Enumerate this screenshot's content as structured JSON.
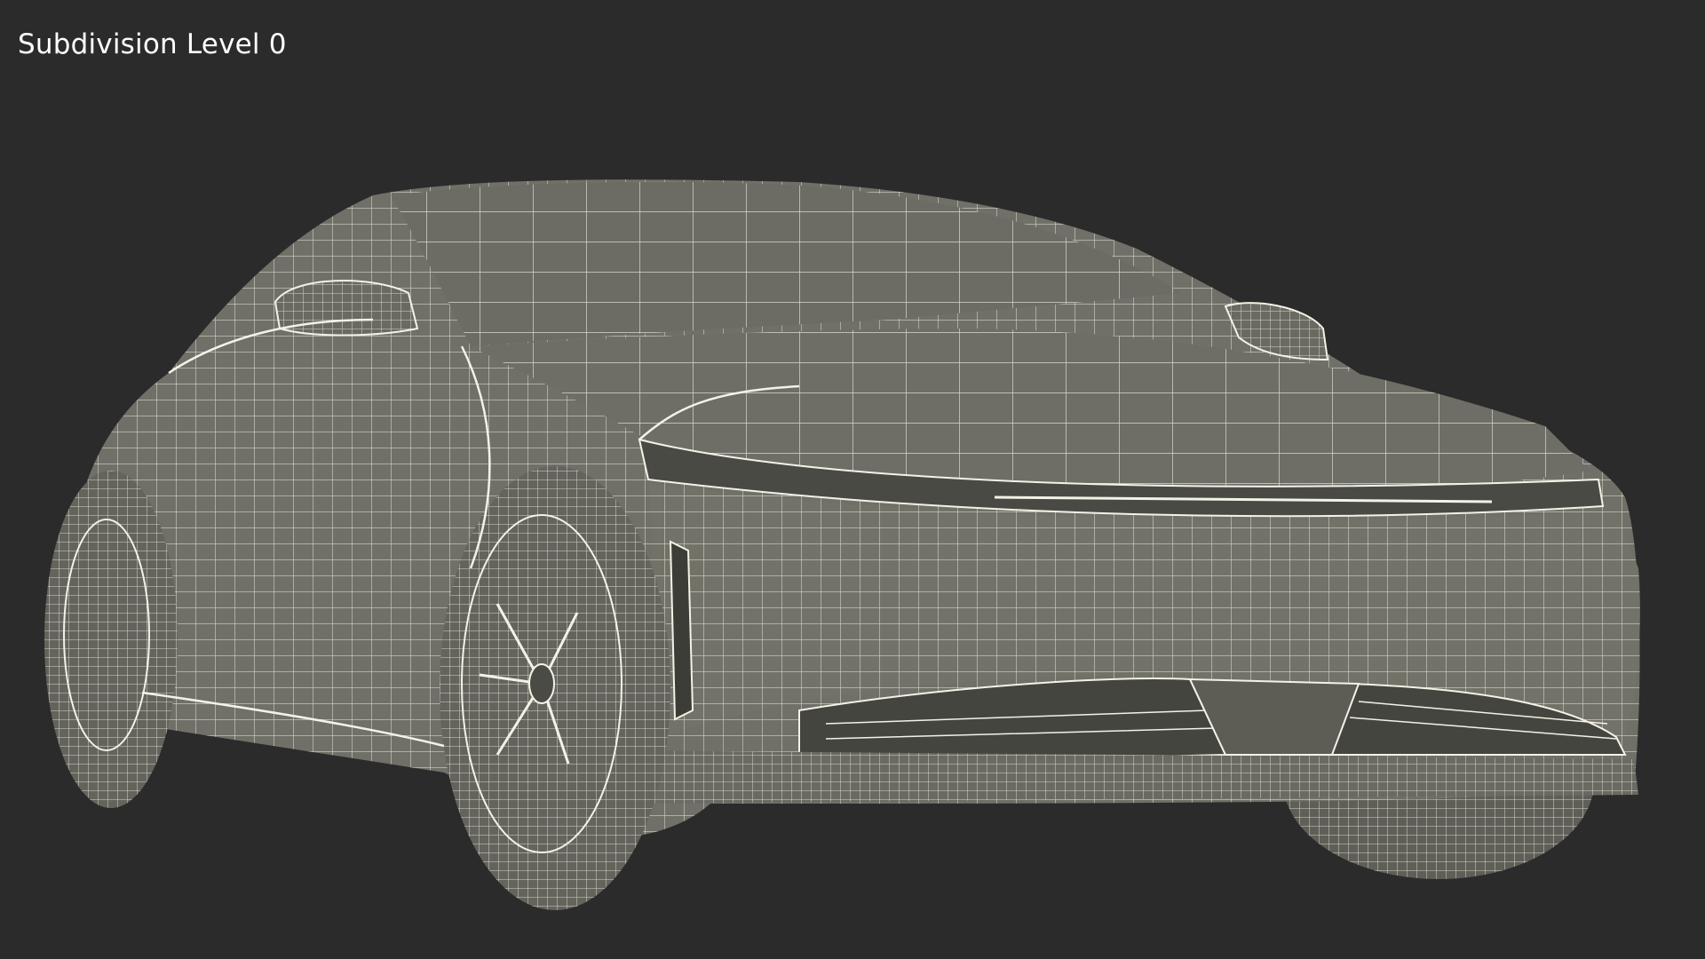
{
  "viewport": {
    "label": "Subdivision Level 0",
    "background_color": "#2b2b2b",
    "wire_color": "#f4f2e6",
    "surface_color": "#707068"
  },
  "model": {
    "render_mode": "wireframe",
    "subject": "sedan"
  }
}
